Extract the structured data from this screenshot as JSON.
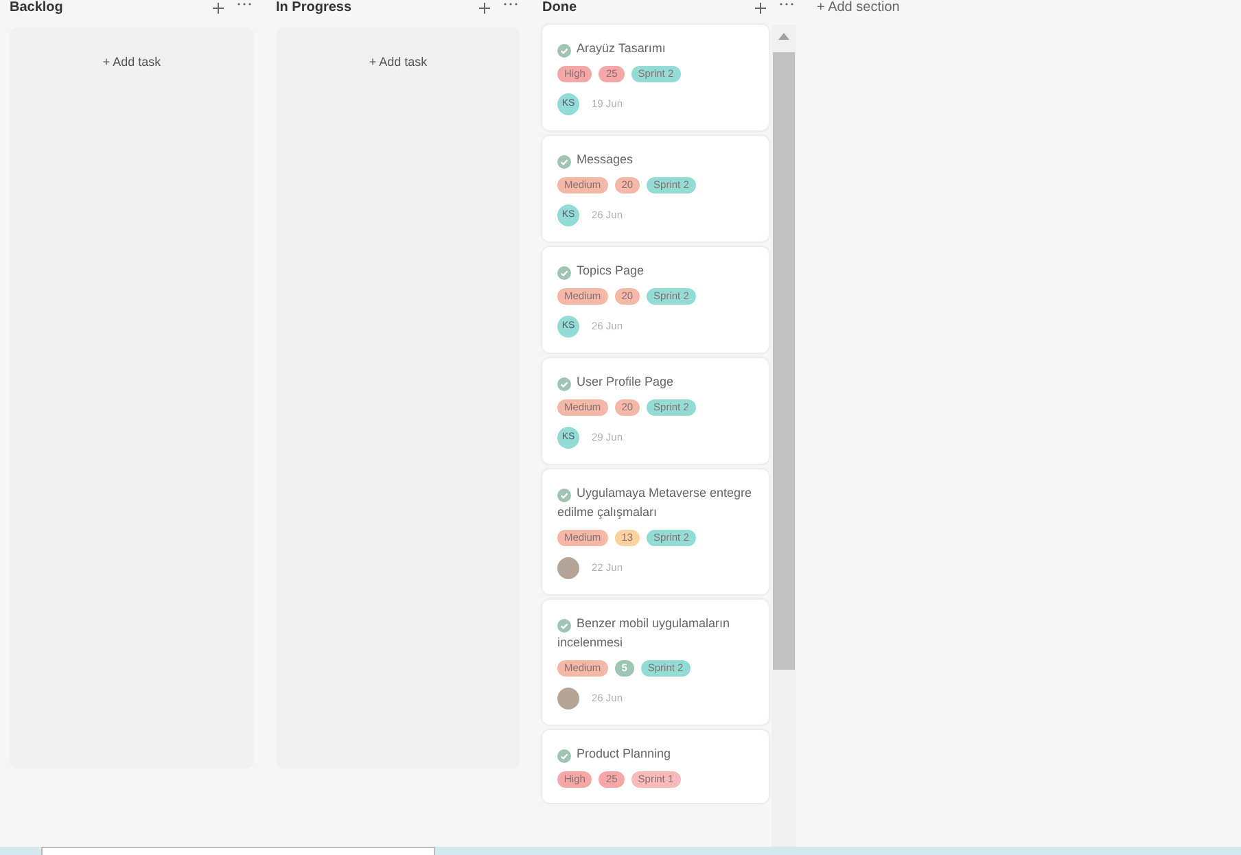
{
  "columns": [
    {
      "title": "Backlog",
      "add_task": "+ Add task"
    },
    {
      "title": "In Progress",
      "add_task": "+ Add task"
    },
    {
      "title": "Done",
      "tasks": [
        {
          "title": "Arayüz Tasarımı",
          "completed": true,
          "tags": [
            {
              "text": "High",
              "color": "#f5a7a7"
            },
            {
              "text": "25",
              "color": "#f5a7a7"
            },
            {
              "text": "Sprint 2",
              "color": "#93dcd6"
            }
          ],
          "assignee": {
            "kind": "initials",
            "text": "KS"
          },
          "due": "19 Jun"
        },
        {
          "title": "Messages",
          "completed": true,
          "tags": [
            {
              "text": "Medium",
              "color": "#f4b8a6"
            },
            {
              "text": "20",
              "color": "#f4b8a6"
            },
            {
              "text": "Sprint 2",
              "color": "#93dcd6"
            }
          ],
          "assignee": {
            "kind": "initials",
            "text": "KS"
          },
          "due": "26 Jun"
        },
        {
          "title": "Topics Page",
          "completed": true,
          "tags": [
            {
              "text": "Medium",
              "color": "#f4b8a6"
            },
            {
              "text": "20",
              "color": "#f4b8a6"
            },
            {
              "text": "Sprint 2",
              "color": "#93dcd6"
            }
          ],
          "assignee": {
            "kind": "initials",
            "text": "KS"
          },
          "due": "26 Jun"
        },
        {
          "title": "User Profile Page",
          "completed": true,
          "tags": [
            {
              "text": "Medium",
              "color": "#f4b8a6"
            },
            {
              "text": "20",
              "color": "#f4b8a6"
            },
            {
              "text": "Sprint 2",
              "color": "#93dcd6"
            }
          ],
          "assignee": {
            "kind": "initials",
            "text": "KS"
          },
          "due": "29 Jun"
        },
        {
          "title": "Uygulamaya Metaverse entegre edilme çalışmaları",
          "completed": true,
          "tags": [
            {
              "text": "Medium",
              "color": "#f4b8a6"
            },
            {
              "text": "13",
              "color": "#f8d3a0"
            },
            {
              "text": "Sprint 2",
              "color": "#93dcd6"
            }
          ],
          "assignee": {
            "kind": "photo"
          },
          "due": "22 Jun"
        },
        {
          "title": "Benzer mobil uygulamaların incelenmesi",
          "completed": true,
          "tags": [
            {
              "text": "Medium",
              "color": "#f4b8a6"
            },
            {
              "text": "5",
              "color": "#9ec5b2"
            },
            {
              "text": "Sprint 2",
              "color": "#93dcd6"
            }
          ],
          "assignee": {
            "kind": "photo"
          },
          "due": "26 Jun"
        },
        {
          "title": "Product Planning",
          "completed": true,
          "tags": [
            {
              "text": "High",
              "color": "#f5a7a7"
            },
            {
              "text": "25",
              "color": "#f5a7a7"
            },
            {
              "text": "Sprint 1",
              "color": "#f8baba"
            }
          ]
        }
      ]
    }
  ],
  "add_section": "+ Add section"
}
